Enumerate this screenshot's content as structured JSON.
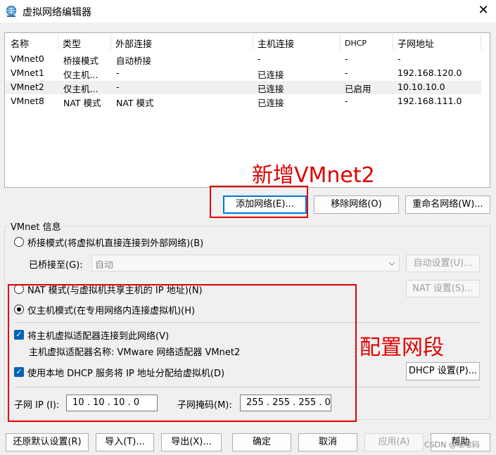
{
  "window": {
    "title": "虚拟网络编辑器",
    "close_glyph": "✕"
  },
  "table": {
    "columns": [
      "名称",
      "类型",
      "外部连接",
      "主机连接",
      "DHCP",
      "子网地址"
    ],
    "rows": [
      [
        "VMnet0",
        "桥接模式",
        "自动桥接",
        "-",
        "-",
        "-"
      ],
      [
        "VMnet1",
        "仅主机...",
        "-",
        "已连接",
        "-",
        "192.168.120.0"
      ],
      [
        "VMnet2",
        "仅主机...",
        "-",
        "已连接",
        "已启用",
        "10.10.10.0"
      ],
      [
        "VMnet8",
        "NAT 模式",
        "NAT 模式",
        "已连接",
        "-",
        "192.168.111.0"
      ]
    ]
  },
  "network_buttons": {
    "add": "添加网络(E)...",
    "remove": "移除网络(O)",
    "rename": "重命名网络(W)..."
  },
  "annotations": {
    "add_note": "新增VMnet2",
    "config_note": "配置网段"
  },
  "vmnet_info": {
    "group_label": "VMnet 信息",
    "bridge_mode": "桥接模式(将虚拟机直接连接到外部网络)(B)",
    "bridged_to_label": "已桥接至(G):",
    "bridged_to_value": "自动",
    "auto_settings": "自动设置(U)...",
    "nat_mode": "NAT 模式(与虚拟机共享主机的 IP 地址)(N)",
    "nat_settings": "NAT 设置(S)...",
    "host_only_mode": "仅主机模式(在专用网络内连接虚拟机)(H)",
    "connect_adapter": "将主机虚拟适配器连接到此网络(V)",
    "adapter_name": "主机虚拟适配器名称: VMware 网络适配器 VMnet2",
    "use_dhcp": "使用本地 DHCP 服务将 IP 地址分配给虚拟机(D)",
    "dhcp_settings": "DHCP 设置(P)...",
    "subnet_ip_label": "子网 IP (I):",
    "subnet_ip": "10 . 10 . 10 . 0",
    "subnet_mask_label": "子网掩码(M):",
    "subnet_mask": "255 . 255 . 255 . 0"
  },
  "footer": {
    "restore": "还原默认设置(R)",
    "import": "导入(T)...",
    "export": "导出(X)...",
    "ok": "确定",
    "cancel": "取消",
    "apply": "应用(A)",
    "help": "帮助"
  },
  "watermark": "CSDN @嗦嗦码"
}
